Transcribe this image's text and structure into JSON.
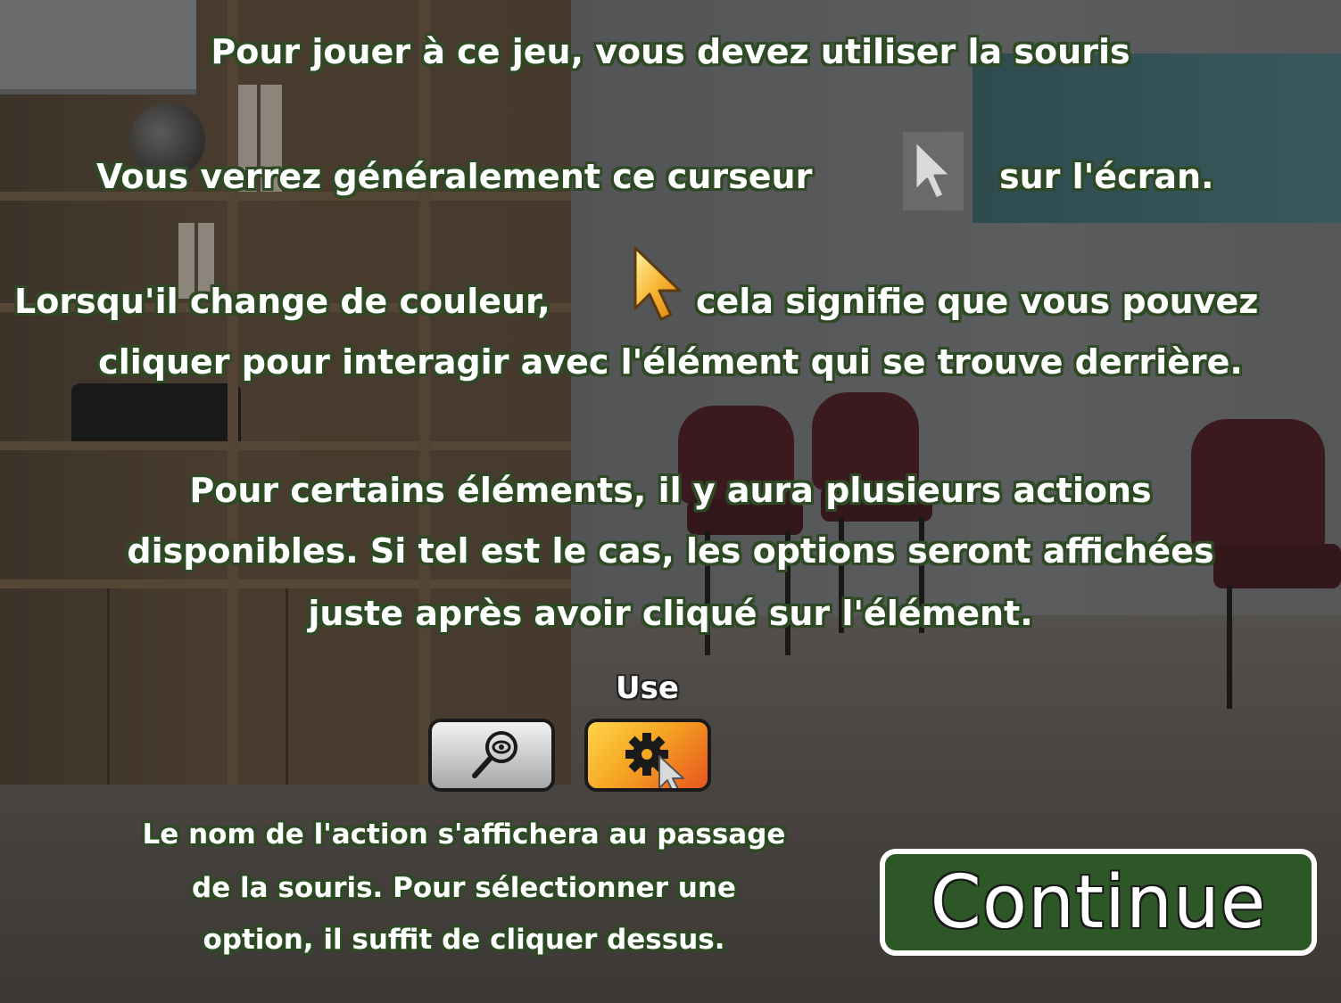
{
  "instructions": {
    "line1": "Pour jouer à ce jeu, vous devez utiliser la souris",
    "line2_before": "Vous verrez généralement ce curseur",
    "line2_after": "sur l'écran.",
    "line3_before": "Lorsqu'il change de couleur,",
    "line3_after": "cela signifie que vous pouvez",
    "line4": "cliquer pour interagir avec l'élément qui se trouve derrière.",
    "line5": "Pour certains éléments, il y aura plusieurs actions",
    "line6": "disponibles. Si tel est le cas, les options seront affichées",
    "line7": "juste après avoir cliqué sur l'élément."
  },
  "cursors": {
    "default_icon": "arrow-cursor-icon",
    "hover_icon": "gold-arrow-cursor-icon"
  },
  "actions": {
    "hover_label": "Use",
    "buttons": [
      {
        "icon": "look-eye-icon",
        "color": "#c9c9c9"
      },
      {
        "icon": "gear-use-icon",
        "color": "#f5a623"
      }
    ]
  },
  "bottom_text": {
    "line1": "Le nom de l'action s'affichera au passage",
    "line2": "de la souris. Pour sélectionner une",
    "line3": "option, il suffit de cliquer dessus."
  },
  "continue_button": {
    "label": "Continue",
    "color": "#2e5728"
  }
}
